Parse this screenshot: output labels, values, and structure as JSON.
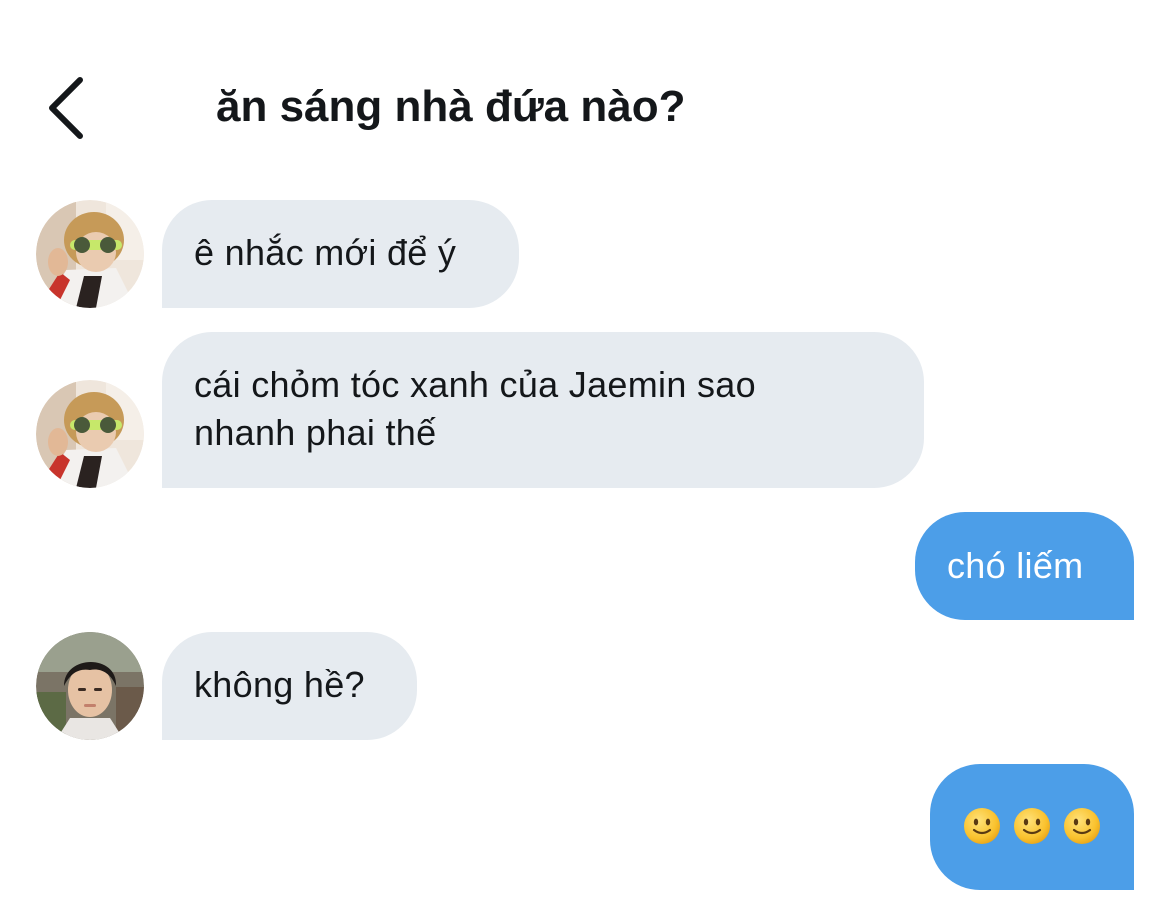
{
  "header": {
    "back_icon": "chevron-left-icon",
    "title": "ăn sáng nhà đứa nào?"
  },
  "messages": [
    {
      "side": "in",
      "avatar": "avatar-sunglasses",
      "text": "ê nhắc mới để ý"
    },
    {
      "side": "in",
      "avatar": "avatar-sunglasses",
      "lines": [
        "cái chỏm tóc xanh của Jaemin sao",
        "nhanh phai thế"
      ]
    },
    {
      "side": "out",
      "text": "chó liếm"
    },
    {
      "side": "in",
      "avatar": "avatar-portrait",
      "text": "không hề?"
    },
    {
      "side": "out",
      "emoji": [
        "slightly-smiling-face-emoji",
        "slightly-smiling-face-emoji",
        "slightly-smiling-face-emoji"
      ]
    }
  ],
  "colors": {
    "incoming_bubble": "#e6ebf0",
    "outgoing_bubble": "#4c9ee8",
    "text": "#14171a"
  }
}
